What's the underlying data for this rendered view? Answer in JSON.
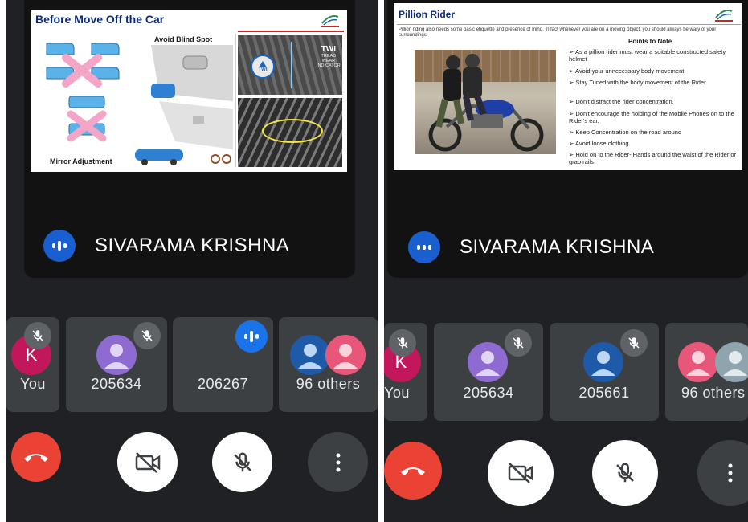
{
  "left": {
    "slide": {
      "title": "Before Move Off the Car",
      "blind_spot_label": "Avoid Blind Spot",
      "mirror_label": "Mirror Adjustment",
      "twi_label": "TWI",
      "twi_line1": "TREAD",
      "twi_line2": "WEAR",
      "twi_line3": "INDICATOR",
      "twi_circle": "TWI"
    },
    "speaker": {
      "name": "SIVARAMA KRISHNA"
    },
    "tiles": [
      {
        "label": "You",
        "initial": "K",
        "muted": true
      },
      {
        "label": "205634",
        "muted": true
      },
      {
        "label": "206267",
        "speaking": true
      },
      {
        "label": "96 others"
      }
    ]
  },
  "right": {
    "slide": {
      "title": "Pillion Rider",
      "intro": "Pillion riding also needs some basic etiquette and presence of mind. In fact whenever you are on a moving object, you should always be wary of your surroundings.",
      "points_title": "Points to Note",
      "points": [
        "As a pillion rider must wear a suitable constructed safety helmet",
        "Avoid your unnecessary body movement",
        "Stay Tuned with the body movement of the Rider",
        "Don't distract the rider concentration.",
        "Don't encourage the holding of the Mobile Phones on to the Rider's ear.",
        "Keep Concentration on the road around",
        "Avoid loose clothing",
        "Hold on to the Rider- Hands around the waist of the Rider or grab rails"
      ],
      "bullet_glyph": "➢"
    },
    "speaker": {
      "name": "SIVARAMA KRISHNA"
    },
    "tiles": [
      {
        "label": "You",
        "initial": "K",
        "muted": true
      },
      {
        "label": "205634",
        "muted": true
      },
      {
        "label": "205661",
        "muted": true
      },
      {
        "label": "96 others"
      }
    ]
  },
  "colors": {
    "background": "#202124",
    "tile": "#3c4043",
    "end_call": "#ea4335",
    "speaking": "#1a73e8",
    "avatar_purple": "#8e6bd0",
    "avatar_blue": "#1e5aa8",
    "avatar_pink": "#e8577a",
    "avatar_you": "#c2185b",
    "avatar_grey": "#90a4ae"
  },
  "icons": {
    "end_call": "phone-hangup-icon",
    "camera": "camera-off-icon",
    "mic": "mic-off-icon",
    "more": "more-vert-icon"
  }
}
